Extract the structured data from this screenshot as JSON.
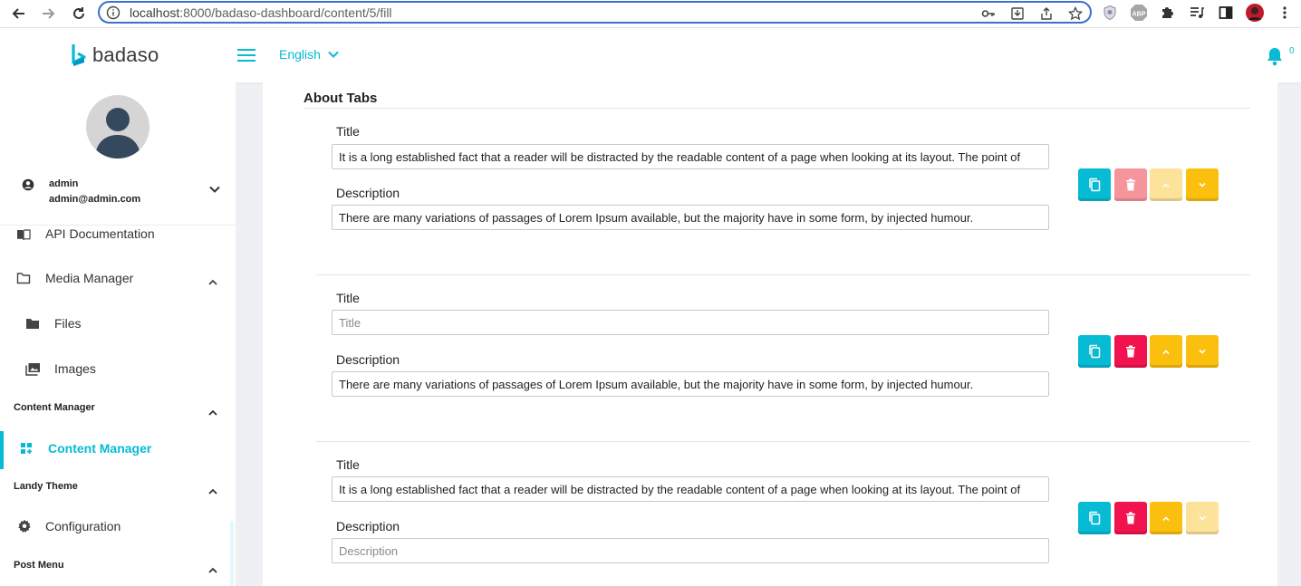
{
  "browser": {
    "url_host": "localhost",
    "url_path": ":8000/badaso-dashboard/content/5/fill",
    "extension_label": "ABP"
  },
  "header": {
    "app_name": "badaso",
    "language": "English",
    "notification_count": "0"
  },
  "sidebar": {
    "user": {
      "name": "admin",
      "email": "admin@admin.com"
    },
    "items": [
      {
        "label": "API Documentation"
      },
      {
        "label": "Media Manager"
      },
      {
        "label": "Files"
      },
      {
        "label": "Images"
      }
    ],
    "groups": [
      {
        "label": "Content Manager"
      },
      {
        "label": "Landy Theme"
      },
      {
        "label": "Post Menu"
      }
    ],
    "content_manager_item": "Content Manager",
    "configuration_item": "Configuration"
  },
  "main": {
    "section_title": "About Tabs",
    "title_label": "Title",
    "description_label": "Description",
    "entries": [
      {
        "title_value": "It is a long established fact that a reader will be distracted by the readable content  of a page when looking at its layout. The point of",
        "title_placeholder": "Title",
        "description_value": "There are many variations of passages of Lorem Ipsum available, but the majority have in some form, by injected humour.",
        "description_placeholder": "Description"
      },
      {
        "title_value": "",
        "title_placeholder": "Title",
        "description_value": "There are many variations of passages of Lorem Ipsum available, but the majority have in some form, by injected humour.",
        "description_placeholder": "Description"
      },
      {
        "title_value": "It is a long established fact that a reader will be distracted by the readable content  of a page when looking at its layout. The point of",
        "title_placeholder": "Title",
        "description_value": "",
        "description_placeholder": "Description"
      }
    ]
  },
  "colors": {
    "accent": "#06bbd3",
    "danger": "#f0134d",
    "warning": "#fbbf0e"
  }
}
